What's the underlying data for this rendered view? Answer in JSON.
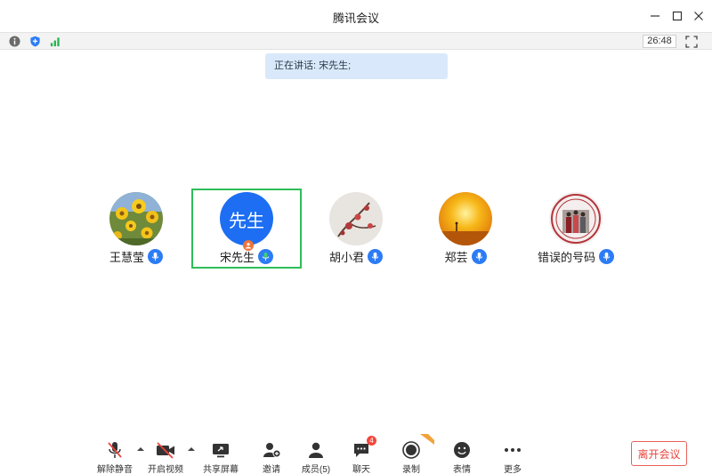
{
  "window": {
    "title": "腾讯会议"
  },
  "status": {
    "timer": "26:48"
  },
  "speaking": {
    "text": "正在讲话: 宋先生;"
  },
  "participants": [
    {
      "name": "王慧莹",
      "active": false
    },
    {
      "name": "宋先生",
      "avatar_text": "先生",
      "active": true
    },
    {
      "name": "胡小君",
      "active": false
    },
    {
      "name": "郑芸",
      "active": false
    },
    {
      "name": "错误的号码",
      "active": false
    }
  ],
  "toolbar": {
    "unmute": "解除静音",
    "start_video": "开启视频",
    "share_screen": "共享屏幕",
    "invite": "邀请",
    "members": "成员(5)",
    "chat": "聊天",
    "chat_badge": "4",
    "record": "录制",
    "reactions": "表情",
    "more": "更多"
  },
  "leave_button": "离开会议",
  "colors": {
    "accent": "#2c7cf6",
    "active_border": "#2ebd59",
    "leave": "#e8453d"
  }
}
